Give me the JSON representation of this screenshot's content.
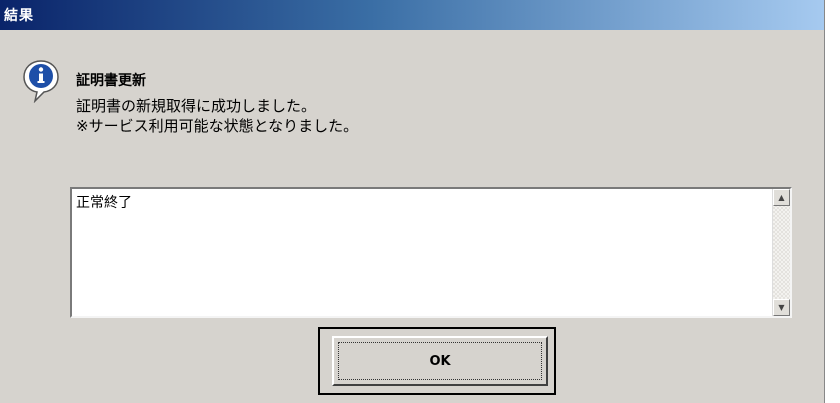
{
  "window": {
    "title": "結果"
  },
  "dialog": {
    "icon": "info-icon",
    "heading": "証明書更新",
    "message_line1": "証明書の新規取得に成功しました。",
    "message_line2": "※サービス利用可能な状態となりました。"
  },
  "result_box": {
    "text": "正常終了"
  },
  "buttons": {
    "ok_label": "OK"
  },
  "colors": {
    "title_start": "#0a246a",
    "title_end": "#a6caf0",
    "dialog_bg": "#d6d3ce",
    "icon_blue": "#1e4fa8"
  }
}
